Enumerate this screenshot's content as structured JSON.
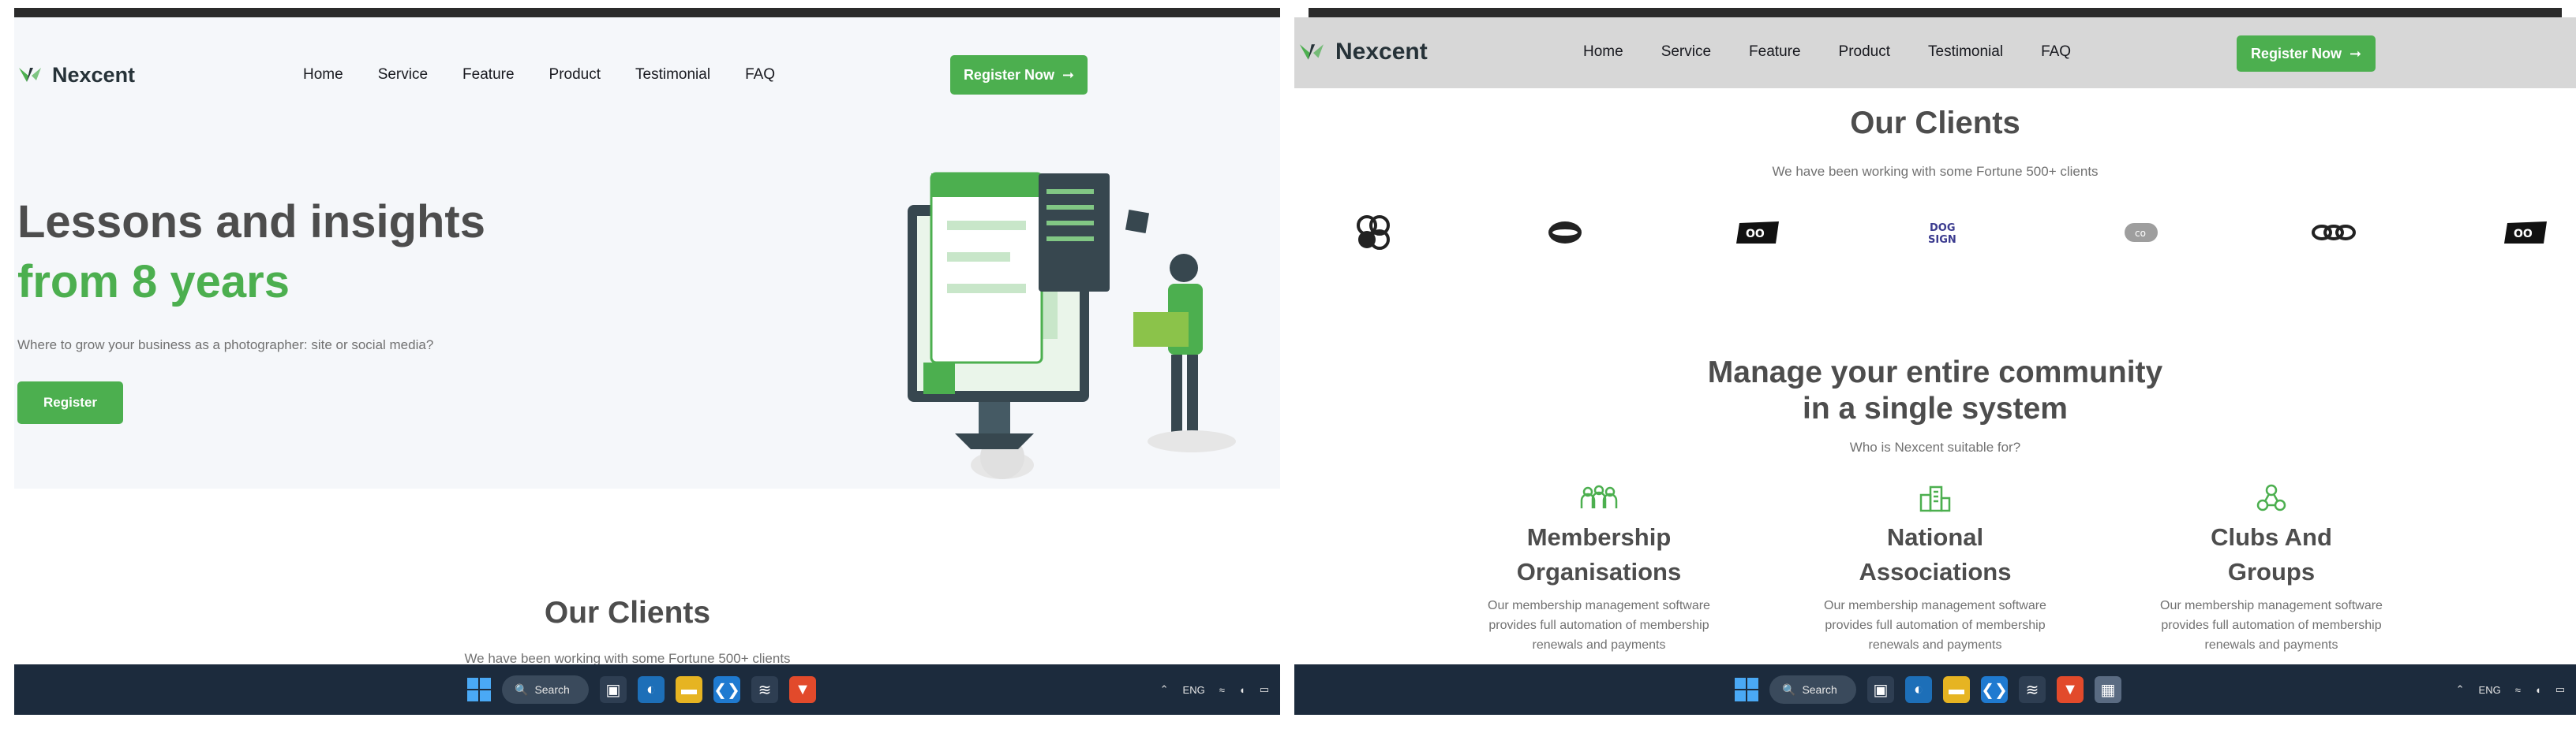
{
  "left": {
    "brand": "Nexcent",
    "nav": [
      "Home",
      "Service",
      "Feature",
      "Product",
      "Testimonial",
      "FAQ"
    ],
    "register_now": "Register Now",
    "hero": {
      "title_line1": "Lessons and insights",
      "title_line2": "from 8 years",
      "subtitle": "Where to grow your business as a photographer: site or social media?",
      "button": "Register"
    },
    "clients_title": "Our Clients",
    "clients_sub": "We have been working with some Fortune 500+ clients"
  },
  "right": {
    "brand": "Nexcent",
    "nav": [
      "Home",
      "Service",
      "Feature",
      "Product",
      "Testimonial",
      "FAQ"
    ],
    "register_now": "Register Now",
    "clients_title": "Our Clients",
    "clients_sub": "We have been working with some Fortune 500+ clients",
    "client_logos": [
      "client-logo-1-icon",
      "client-logo-2-icon",
      "client-logo-3-icon",
      "client-logo-4-icon",
      "client-logo-5-icon",
      "client-logo-6-icon",
      "client-logo-7-icon"
    ],
    "manage_title_line1": "Manage your entire community",
    "manage_title_line2": "in a single system",
    "manage_sub": "Who is Nexcent suitable for?",
    "cards": [
      {
        "title_line1": "Membership",
        "title_line2": "Organisations",
        "text_line1": "Our membership management software",
        "text_line2": "provides full automation of membership",
        "text_line3": "renewals and payments"
      },
      {
        "title_line1": "National",
        "title_line2": "Associations",
        "text_line1": "Our membership management software",
        "text_line2": "provides full automation of membership",
        "text_line3": "renewals and payments"
      },
      {
        "title_line1": "Clubs And",
        "title_line2": "Groups",
        "text_line1": "Our membership management software",
        "text_line2": "provides full automation of membership",
        "text_line3": "renewals and payments"
      }
    ]
  },
  "taskbar": {
    "search": "Search",
    "lang": "ENG"
  },
  "colors": {
    "accent": "#4caf4f",
    "text_dark": "#4d4d4d",
    "text_muted": "#717171",
    "hero_bg": "#f5f7fa",
    "taskbar": "#1c2b3d"
  }
}
